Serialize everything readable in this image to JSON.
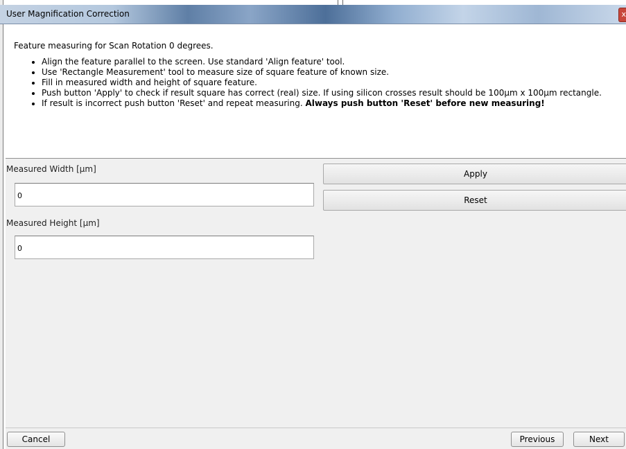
{
  "window": {
    "title": "User Magnification Correction",
    "close_glyph": "x"
  },
  "intro": {
    "lead": "Feature measuring for Scan Rotation 0 degrees.",
    "bullets": [
      "Align the feature parallel to the screen. Use standard 'Align feature' tool.",
      "Use 'Rectangle Measurement' tool to measure size of square feature of known size.",
      "Fill in measured width and height of square feature.",
      "Push button 'Apply' to check if result square has correct (real) size. If using silicon crosses result should be 100µm x 100µm rectangle.",
      "If result is incorrect push button 'Reset' and repeat measuring. "
    ],
    "bullet5_bold": "Always push button 'Reset' before new measuring!"
  },
  "form": {
    "width_label": "Measured Width [µm]",
    "width_value": "0",
    "height_label": "Measured Height [µm]",
    "height_value": "0",
    "apply_label": "Apply",
    "reset_label": "Reset"
  },
  "footer": {
    "cancel_label": "Cancel",
    "previous_label": "Previous",
    "next_label": "Next"
  },
  "colors": {
    "panel_bg": "#f0f0f0",
    "close_button": "#c7463a"
  }
}
